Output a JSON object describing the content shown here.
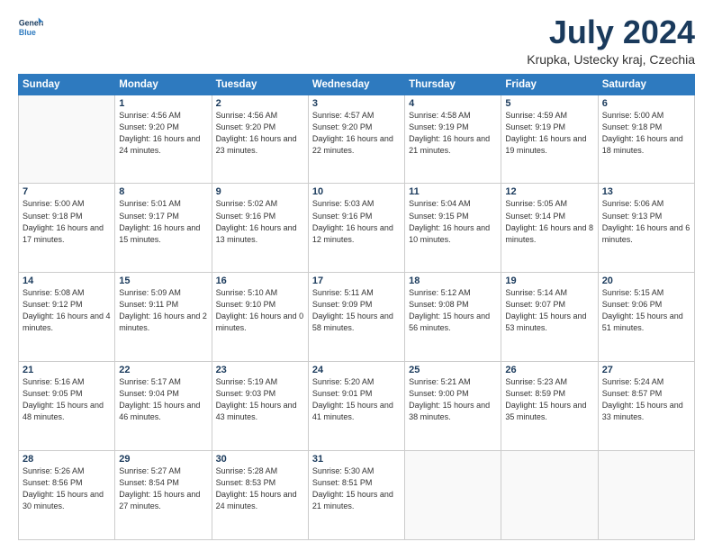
{
  "header": {
    "logo_line1": "General",
    "logo_line2": "Blue",
    "month_year": "July 2024",
    "location": "Krupka, Ustecky kraj, Czechia"
  },
  "weekdays": [
    "Sunday",
    "Monday",
    "Tuesday",
    "Wednesday",
    "Thursday",
    "Friday",
    "Saturday"
  ],
  "weeks": [
    [
      {
        "day": "",
        "sunrise": "",
        "sunset": "",
        "daylight": ""
      },
      {
        "day": "1",
        "sunrise": "Sunrise: 4:56 AM",
        "sunset": "Sunset: 9:20 PM",
        "daylight": "Daylight: 16 hours and 24 minutes."
      },
      {
        "day": "2",
        "sunrise": "Sunrise: 4:56 AM",
        "sunset": "Sunset: 9:20 PM",
        "daylight": "Daylight: 16 hours and 23 minutes."
      },
      {
        "day": "3",
        "sunrise": "Sunrise: 4:57 AM",
        "sunset": "Sunset: 9:20 PM",
        "daylight": "Daylight: 16 hours and 22 minutes."
      },
      {
        "day": "4",
        "sunrise": "Sunrise: 4:58 AM",
        "sunset": "Sunset: 9:19 PM",
        "daylight": "Daylight: 16 hours and 21 minutes."
      },
      {
        "day": "5",
        "sunrise": "Sunrise: 4:59 AM",
        "sunset": "Sunset: 9:19 PM",
        "daylight": "Daylight: 16 hours and 19 minutes."
      },
      {
        "day": "6",
        "sunrise": "Sunrise: 5:00 AM",
        "sunset": "Sunset: 9:18 PM",
        "daylight": "Daylight: 16 hours and 18 minutes."
      }
    ],
    [
      {
        "day": "7",
        "sunrise": "Sunrise: 5:00 AM",
        "sunset": "Sunset: 9:18 PM",
        "daylight": "Daylight: 16 hours and 17 minutes."
      },
      {
        "day": "8",
        "sunrise": "Sunrise: 5:01 AM",
        "sunset": "Sunset: 9:17 PM",
        "daylight": "Daylight: 16 hours and 15 minutes."
      },
      {
        "day": "9",
        "sunrise": "Sunrise: 5:02 AM",
        "sunset": "Sunset: 9:16 PM",
        "daylight": "Daylight: 16 hours and 13 minutes."
      },
      {
        "day": "10",
        "sunrise": "Sunrise: 5:03 AM",
        "sunset": "Sunset: 9:16 PM",
        "daylight": "Daylight: 16 hours and 12 minutes."
      },
      {
        "day": "11",
        "sunrise": "Sunrise: 5:04 AM",
        "sunset": "Sunset: 9:15 PM",
        "daylight": "Daylight: 16 hours and 10 minutes."
      },
      {
        "day": "12",
        "sunrise": "Sunrise: 5:05 AM",
        "sunset": "Sunset: 9:14 PM",
        "daylight": "Daylight: 16 hours and 8 minutes."
      },
      {
        "day": "13",
        "sunrise": "Sunrise: 5:06 AM",
        "sunset": "Sunset: 9:13 PM",
        "daylight": "Daylight: 16 hours and 6 minutes."
      }
    ],
    [
      {
        "day": "14",
        "sunrise": "Sunrise: 5:08 AM",
        "sunset": "Sunset: 9:12 PM",
        "daylight": "Daylight: 16 hours and 4 minutes."
      },
      {
        "day": "15",
        "sunrise": "Sunrise: 5:09 AM",
        "sunset": "Sunset: 9:11 PM",
        "daylight": "Daylight: 16 hours and 2 minutes."
      },
      {
        "day": "16",
        "sunrise": "Sunrise: 5:10 AM",
        "sunset": "Sunset: 9:10 PM",
        "daylight": "Daylight: 16 hours and 0 minutes."
      },
      {
        "day": "17",
        "sunrise": "Sunrise: 5:11 AM",
        "sunset": "Sunset: 9:09 PM",
        "daylight": "Daylight: 15 hours and 58 minutes."
      },
      {
        "day": "18",
        "sunrise": "Sunrise: 5:12 AM",
        "sunset": "Sunset: 9:08 PM",
        "daylight": "Daylight: 15 hours and 56 minutes."
      },
      {
        "day": "19",
        "sunrise": "Sunrise: 5:14 AM",
        "sunset": "Sunset: 9:07 PM",
        "daylight": "Daylight: 15 hours and 53 minutes."
      },
      {
        "day": "20",
        "sunrise": "Sunrise: 5:15 AM",
        "sunset": "Sunset: 9:06 PM",
        "daylight": "Daylight: 15 hours and 51 minutes."
      }
    ],
    [
      {
        "day": "21",
        "sunrise": "Sunrise: 5:16 AM",
        "sunset": "Sunset: 9:05 PM",
        "daylight": "Daylight: 15 hours and 48 minutes."
      },
      {
        "day": "22",
        "sunrise": "Sunrise: 5:17 AM",
        "sunset": "Sunset: 9:04 PM",
        "daylight": "Daylight: 15 hours and 46 minutes."
      },
      {
        "day": "23",
        "sunrise": "Sunrise: 5:19 AM",
        "sunset": "Sunset: 9:03 PM",
        "daylight": "Daylight: 15 hours and 43 minutes."
      },
      {
        "day": "24",
        "sunrise": "Sunrise: 5:20 AM",
        "sunset": "Sunset: 9:01 PM",
        "daylight": "Daylight: 15 hours and 41 minutes."
      },
      {
        "day": "25",
        "sunrise": "Sunrise: 5:21 AM",
        "sunset": "Sunset: 9:00 PM",
        "daylight": "Daylight: 15 hours and 38 minutes."
      },
      {
        "day": "26",
        "sunrise": "Sunrise: 5:23 AM",
        "sunset": "Sunset: 8:59 PM",
        "daylight": "Daylight: 15 hours and 35 minutes."
      },
      {
        "day": "27",
        "sunrise": "Sunrise: 5:24 AM",
        "sunset": "Sunset: 8:57 PM",
        "daylight": "Daylight: 15 hours and 33 minutes."
      }
    ],
    [
      {
        "day": "28",
        "sunrise": "Sunrise: 5:26 AM",
        "sunset": "Sunset: 8:56 PM",
        "daylight": "Daylight: 15 hours and 30 minutes."
      },
      {
        "day": "29",
        "sunrise": "Sunrise: 5:27 AM",
        "sunset": "Sunset: 8:54 PM",
        "daylight": "Daylight: 15 hours and 27 minutes."
      },
      {
        "day": "30",
        "sunrise": "Sunrise: 5:28 AM",
        "sunset": "Sunset: 8:53 PM",
        "daylight": "Daylight: 15 hours and 24 minutes."
      },
      {
        "day": "31",
        "sunrise": "Sunrise: 5:30 AM",
        "sunset": "Sunset: 8:51 PM",
        "daylight": "Daylight: 15 hours and 21 minutes."
      },
      {
        "day": "",
        "sunrise": "",
        "sunset": "",
        "daylight": ""
      },
      {
        "day": "",
        "sunrise": "",
        "sunset": "",
        "daylight": ""
      },
      {
        "day": "",
        "sunrise": "",
        "sunset": "",
        "daylight": ""
      }
    ]
  ]
}
